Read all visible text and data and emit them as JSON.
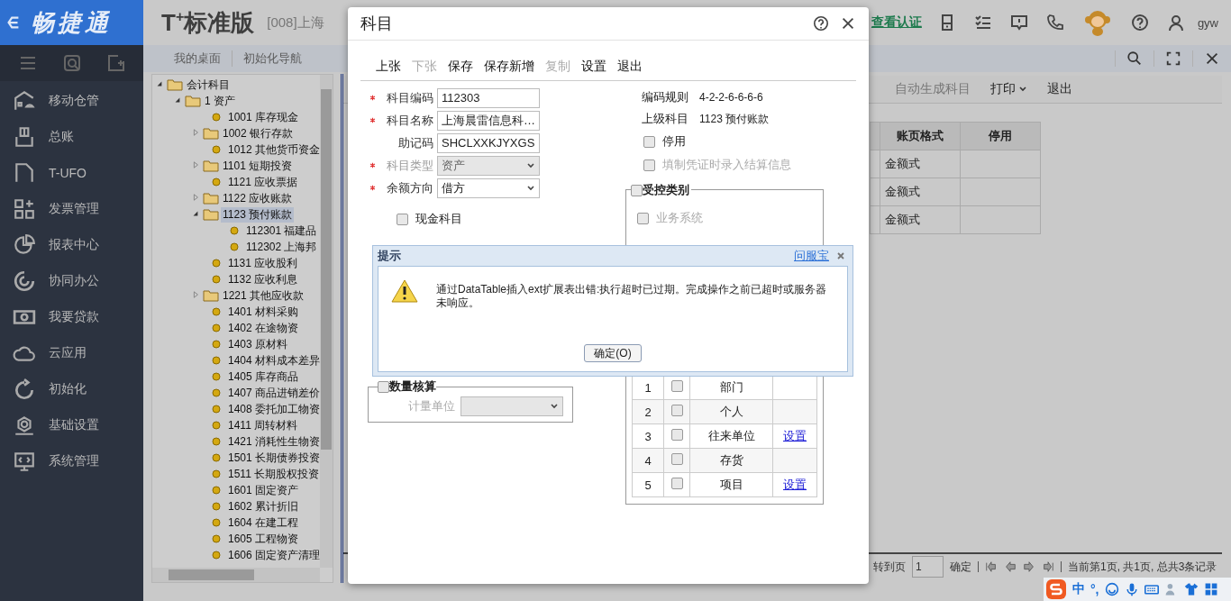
{
  "sidebar": {
    "logo": "畅捷通",
    "items": [
      {
        "label": "移动仓管"
      },
      {
        "label": "总账"
      },
      {
        "label": "T-UFO"
      },
      {
        "label": "发票管理"
      },
      {
        "label": "报表中心"
      },
      {
        "label": "协同办公"
      },
      {
        "label": "我要贷款"
      },
      {
        "label": "云应用"
      },
      {
        "label": "初始化"
      },
      {
        "label": "基础设置"
      },
      {
        "label": "系统管理"
      }
    ]
  },
  "header": {
    "product": "T$^{+}$标准版",
    "company": "[008]上海",
    "auth_link": "查看认证",
    "user": "gyw"
  },
  "tabs": [
    {
      "label": "我的桌面",
      "selected": false
    },
    {
      "label": "初始化导航",
      "selected": false
    }
  ],
  "tree": [
    {
      "label": "会计科目",
      "kind": "folder",
      "expanded": true,
      "selected": false,
      "children": [
        {
          "label": "1 资产",
          "kind": "folder",
          "expanded": true,
          "selected": false,
          "children": [
            {
              "label": "1001 库存现金",
              "kind": "leaf",
              "selected": false
            },
            {
              "label": "1002 银行存款",
              "kind": "folder",
              "expanded": false,
              "selected": false
            },
            {
              "label": "1012 其他货币资金",
              "kind": "leaf",
              "selected": false
            },
            {
              "label": "1101 短期投资",
              "kind": "folder",
              "expanded": false,
              "selected": false
            },
            {
              "label": "1121 应收票据",
              "kind": "leaf",
              "selected": false
            },
            {
              "label": "1122 应收账款",
              "kind": "folder",
              "expanded": false,
              "selected": false
            },
            {
              "label": "1123 预付账款",
              "kind": "folder",
              "expanded": true,
              "selected": true,
              "children": [
                {
                  "label": "112301 福建品",
                  "kind": "leaf",
                  "selected": false
                },
                {
                  "label": "112302 上海邦",
                  "kind": "leaf",
                  "selected": false
                }
              ]
            },
            {
              "label": "1131 应收股利",
              "kind": "leaf",
              "selected": false
            },
            {
              "label": "1132 应收利息",
              "kind": "leaf",
              "selected": false
            },
            {
              "label": "1221 其他应收款",
              "kind": "folder",
              "expanded": false,
              "selected": false
            },
            {
              "label": "1401 材料采购",
              "kind": "leaf",
              "selected": false
            },
            {
              "label": "1402 在途物资",
              "kind": "leaf",
              "selected": false
            },
            {
              "label": "1403 原材料",
              "kind": "leaf",
              "selected": false
            },
            {
              "label": "1404 材料成本差异",
              "kind": "leaf",
              "selected": false
            },
            {
              "label": "1405 库存商品",
              "kind": "leaf",
              "selected": false
            },
            {
              "label": "1407 商品进销差价",
              "kind": "leaf",
              "selected": false
            },
            {
              "label": "1408 委托加工物资",
              "kind": "leaf",
              "selected": false
            },
            {
              "label": "1411 周转材料",
              "kind": "leaf",
              "selected": false
            },
            {
              "label": "1421 消耗性生物资",
              "kind": "leaf",
              "selected": false
            },
            {
              "label": "1501 长期债券投资",
              "kind": "leaf",
              "selected": false
            },
            {
              "label": "1511 长期股权投资",
              "kind": "leaf",
              "selected": false
            },
            {
              "label": "1601 固定资产",
              "kind": "leaf",
              "selected": false
            },
            {
              "label": "1602 累计折旧",
              "kind": "leaf",
              "selected": false
            },
            {
              "label": "1604 在建工程",
              "kind": "leaf",
              "selected": false
            },
            {
              "label": "1605 工程物资",
              "kind": "leaf",
              "selected": false
            },
            {
              "label": "1606 固定资产清理",
              "kind": "leaf",
              "selected": false
            }
          ]
        }
      ]
    }
  ],
  "toolbar": [
    {
      "label": "自动生成科目",
      "disabled": true,
      "dropdown": false
    },
    {
      "label": "打印",
      "disabled": false,
      "dropdown": true
    },
    {
      "label": "退出",
      "disabled": false,
      "dropdown": false
    }
  ],
  "table": {
    "columns": [
      "账页格式",
      "停用"
    ],
    "rows": [
      [
        "金额式"
      ],
      [
        "金额式"
      ],
      [
        "金额式"
      ]
    ]
  },
  "pager": {
    "jump_label": "转到页",
    "page": "1",
    "confirm": "确定",
    "info": "当前第1页, 共1页, 总共3条记录"
  },
  "dialog": {
    "title": "科目",
    "toolbar": [
      {
        "label": "上张",
        "disabled": false
      },
      {
        "label": "下张",
        "disabled": true
      },
      {
        "label": "保存",
        "disabled": false
      },
      {
        "label": "保存新增",
        "disabled": false
      },
      {
        "label": "复制",
        "disabled": true
      },
      {
        "label": "设置",
        "disabled": false
      },
      {
        "label": "退出",
        "disabled": false
      }
    ],
    "fields": [
      {
        "label": "科目编码",
        "required": true,
        "kind": "text",
        "value": "112303",
        "disabled": false
      },
      {
        "label": "科目名称",
        "required": true,
        "kind": "text",
        "value": "上海晨雷信息科…",
        "disabled": false
      },
      {
        "label": "助记码",
        "required": false,
        "kind": "text",
        "value": "SHCLXXKJYXGS",
        "disabled": false
      },
      {
        "label": "科目类型",
        "required": true,
        "kind": "select",
        "value": "资产",
        "disabled": true
      },
      {
        "label": "余额方向",
        "required": true,
        "kind": "select",
        "value": "借方",
        "disabled": false
      }
    ],
    "cash": {
      "label": "现金科目",
      "checked": false
    },
    "quantity": {
      "title": "数量核算",
      "checked": false,
      "unit_label": "计量单位"
    },
    "info": [
      {
        "label": "编码规则",
        "value": "4-2-2-6-6-6-6"
      },
      {
        "label": "上级科目",
        "value": "1123  预付账款"
      }
    ],
    "options": [
      {
        "label": "停用",
        "checked": false,
        "disabled": false
      },
      {
        "label": "填制凭证时录入结算信息",
        "checked": false,
        "disabled": true
      }
    ],
    "controlled": {
      "title": "受控类别",
      "checked": false,
      "system": {
        "label": "业务系统",
        "checked": false,
        "disabled": true
      },
      "rows": [
        {
          "no": "1",
          "name": "部门",
          "checked": false
        },
        {
          "no": "2",
          "name": "个人",
          "checked": false
        },
        {
          "no": "3",
          "name": "往来单位",
          "checked": false,
          "link": "设置"
        },
        {
          "no": "4",
          "name": "存货",
          "checked": false
        },
        {
          "no": "5",
          "name": "项目",
          "checked": false,
          "link": "设置"
        }
      ]
    }
  },
  "alert": {
    "title": "提示",
    "link": "问服宝",
    "message": "通过DataTable插入ext扩展表出错:执行超时已过期。完成操作之前已超时或服务器未响应。",
    "button": "确定(O)"
  },
  "ime": {
    "mode": "中",
    "punct": "°,"
  }
}
